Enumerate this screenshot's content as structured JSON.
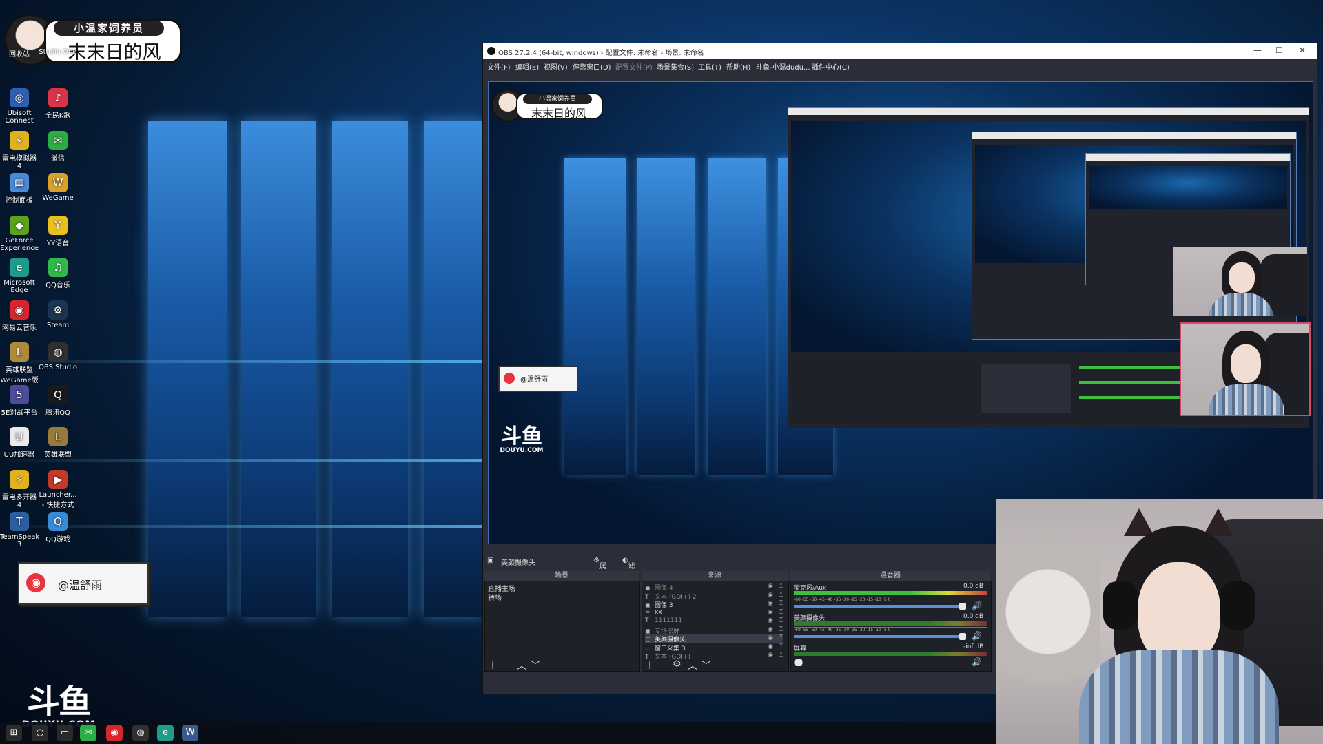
{
  "badge": {
    "line1": "小温家饲养员",
    "line2": "末末日的风"
  },
  "desktop": {
    "icons": [
      {
        "label": "回收站",
        "icon": "recycle-bin-icon",
        "glyph": "🗑",
        "color": "#3a72c4"
      },
      {
        "label": "Studio One",
        "icon": "studio-one-icon",
        "glyph": "S",
        "color": "#1b4f8e"
      },
      {
        "label": "Ubisoft Connect",
        "icon": "ubisoft-connect-icon",
        "glyph": "◎",
        "color": "#2f5fb0"
      },
      {
        "label": "全民K歌",
        "icon": "quanmin-kge-icon",
        "glyph": "♪",
        "color": "#d9344a"
      },
      {
        "label": "雷电模拟器4",
        "icon": "leidian-emulator-icon",
        "glyph": "⚡",
        "color": "#e0b21e"
      },
      {
        "label": "微信",
        "icon": "wechat-icon",
        "glyph": "✉",
        "color": "#2aae45"
      },
      {
        "label": "控制面板",
        "icon": "control-panel-icon",
        "glyph": "▤",
        "color": "#4a8ad6"
      },
      {
        "label": "WeGame",
        "icon": "wegame-icon",
        "glyph": "W",
        "color": "#d9a329"
      },
      {
        "label": "GeForce Experience",
        "icon": "geforce-experience-icon",
        "glyph": "◆",
        "color": "#5ca21f"
      },
      {
        "label": "YY语音",
        "icon": "yy-voice-icon",
        "glyph": "Y",
        "color": "#e8c020"
      },
      {
        "label": "Microsoft Edge",
        "icon": "microsoft-edge-icon",
        "glyph": "e",
        "color": "#1f9b8c"
      },
      {
        "label": "QQ音乐",
        "icon": "qq-music-icon",
        "glyph": "♫",
        "color": "#30b94a"
      },
      {
        "label": "网易云音乐",
        "icon": "netease-music-icon",
        "glyph": "◉",
        "color": "#d8262f"
      },
      {
        "label": "Steam",
        "icon": "steam-icon",
        "glyph": "⚙",
        "color": "#1a3552"
      },
      {
        "label": "英雄联盟WeGame版",
        "icon": "league-wegame-icon",
        "glyph": "L",
        "color": "#b08a3c"
      },
      {
        "label": "OBS Studio",
        "icon": "obs-studio-icon",
        "glyph": "◍",
        "color": "#303030"
      },
      {
        "label": "5E对战平台",
        "icon": "5e-platform-icon",
        "glyph": "5",
        "color": "#4c4c9a"
      },
      {
        "label": "腾讯QQ",
        "icon": "tencent-qq-icon",
        "glyph": "Q",
        "color": "#1a1a1a"
      },
      {
        "label": "UU加速器",
        "icon": "uu-accelerator-icon",
        "glyph": "U",
        "color": "#eaeaea"
      },
      {
        "label": "英雄联盟",
        "icon": "league-of-legends-icon",
        "glyph": "L",
        "color": "#9a7a3a"
      },
      {
        "label": "雷电多开器4",
        "icon": "leidian-multi-icon",
        "glyph": "⚡",
        "color": "#e0b21e"
      },
      {
        "label": "Launcher... - 快捷方式",
        "icon": "launcher-shortcut-icon",
        "glyph": "▶",
        "color": "#c23a2a"
      },
      {
        "label": "TeamSpeak 3",
        "icon": "teamspeak-icon",
        "glyph": "T",
        "color": "#2b5fa0"
      },
      {
        "label": "QQ游戏",
        "icon": "qq-game-icon",
        "glyph": "Q",
        "color": "#3a8ad6"
      }
    ]
  },
  "note_card": {
    "text": "@温舒雨"
  },
  "douyu": {
    "mark": "斗鱼",
    "sub": "DOUYU.COM"
  },
  "taskbar": {
    "icons": [
      {
        "name": "start-icon",
        "glyph": "⊞",
        "color": "#2a2a2a"
      },
      {
        "name": "search-icon",
        "glyph": "○",
        "color": "#2a2a2a"
      },
      {
        "name": "taskview-icon",
        "glyph": "▭",
        "color": "#2a2a2a"
      },
      {
        "name": "wechat-icon",
        "glyph": "✉",
        "color": "#2aae45"
      },
      {
        "name": "netease-music-icon",
        "glyph": "◉",
        "color": "#d8262f"
      },
      {
        "name": "obs-studio-icon",
        "glyph": "◍",
        "color": "#303030"
      },
      {
        "name": "microsoft-edge-icon",
        "glyph": "e",
        "color": "#1f9b8c"
      },
      {
        "name": "wegame-icon",
        "glyph": "W",
        "color": "#3a5a8a"
      }
    ]
  },
  "obs": {
    "title": "OBS 27.2.4 (64-bit, windows) - 配置文件: 未命名 - 场景: 未命名",
    "menu": [
      "文件(F)",
      "编辑(E)",
      "视图(V)",
      "停靠窗口(D)",
      "配置文件(P)",
      "场景集合(S)",
      "工具(T)",
      "帮助(H)",
      "斗鱼-小温dudu...",
      "插件中心(C)"
    ],
    "dock_strip": {
      "source": "美颜摄像头",
      "properties": "属性",
      "filters": "滤镜"
    },
    "scenes": {
      "header": "场景",
      "items": [
        "直播主场",
        "转场"
      ]
    },
    "sources": {
      "header": "来源",
      "items": [
        {
          "name": "图像 4",
          "icon": "image-icon",
          "glyph": "▣"
        },
        {
          "name": "文本 (GDI+) 2",
          "icon": "text-icon",
          "glyph": "T"
        },
        {
          "name": "图像 3",
          "icon": "image-icon",
          "glyph": "▣"
        },
        {
          "name": "xx",
          "icon": "link-icon",
          "glyph": "∞"
        },
        {
          "name": "1111111",
          "icon": "text-icon",
          "glyph": "T"
        },
        {
          "name": "专场黑屏",
          "icon": "image-icon",
          "glyph": "▣"
        },
        {
          "name": "美颜摄像头",
          "icon": "camera-icon",
          "glyph": "◫"
        },
        {
          "name": "窗口采集 3",
          "icon": "window-capture-icon",
          "glyph": "▭"
        },
        {
          "name": "文本 (GDI+)",
          "icon": "text-icon",
          "glyph": "T"
        }
      ]
    },
    "mixer": {
      "header": "混音器",
      "channels": [
        {
          "name": "麦克风/Aux",
          "db": "0.0 dB"
        },
        {
          "name": "美颜摄像头",
          "db": "0.0 dB"
        },
        {
          "name": "屏幕",
          "db": "-inf dB"
        }
      ]
    },
    "meter_ticks": "-60 -55 -50 -45 -40 -35 -30 -25 -20 -15 -10 -5 0",
    "nested_title": "OBS 27.2.4 (64-bit, windows) - 配置文件: 未命名 - 场景: 未命名"
  }
}
